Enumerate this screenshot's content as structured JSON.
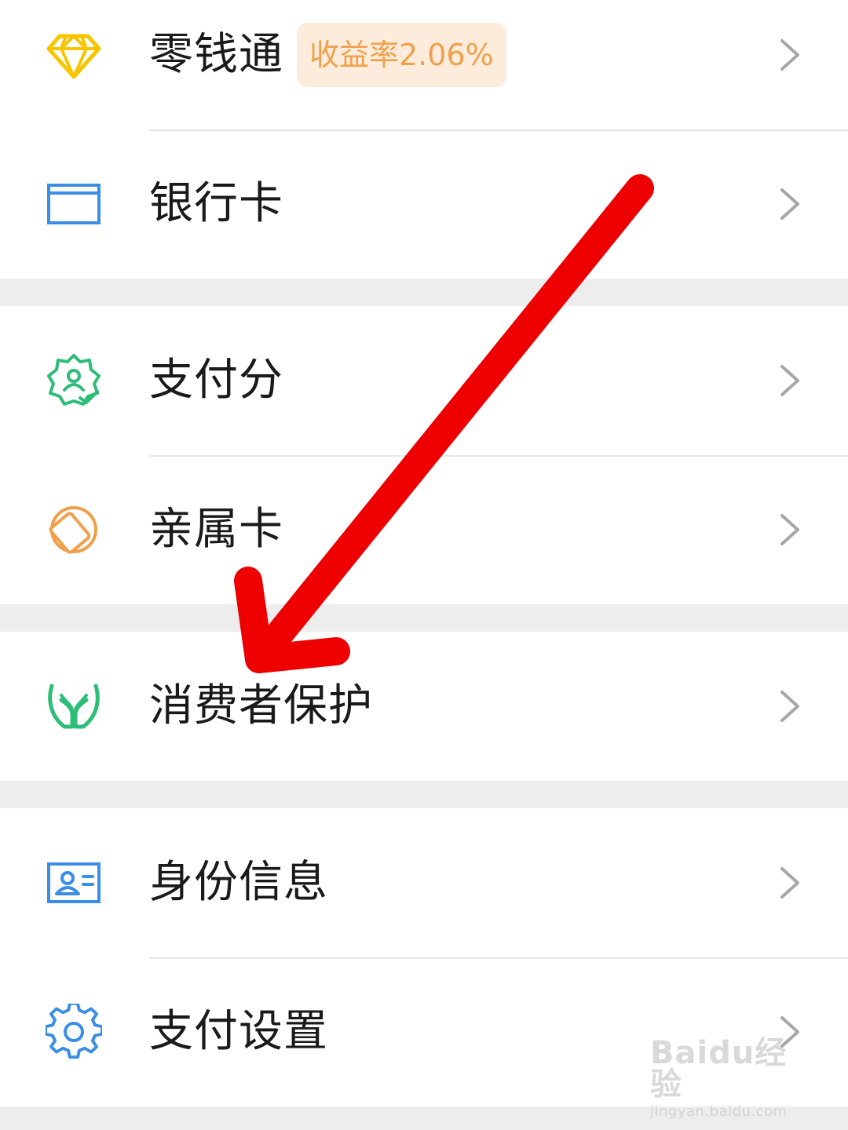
{
  "groups": [
    {
      "items": [
        {
          "label": "零钱通",
          "badge": "收益率2.06%",
          "icon": "diamond-icon"
        },
        {
          "label": "银行卡",
          "icon": "bank-card-icon"
        }
      ]
    },
    {
      "items": [
        {
          "label": "支付分",
          "icon": "credit-score-badge-icon"
        },
        {
          "label": "亲属卡",
          "icon": "family-card-icon"
        }
      ]
    },
    {
      "items": [
        {
          "label": "消费者保护",
          "icon": "protection-hands-icon"
        }
      ]
    },
    {
      "items": [
        {
          "label": "身份信息",
          "icon": "id-card-icon"
        },
        {
          "label": "支付设置",
          "icon": "gear-icon"
        }
      ]
    }
  ],
  "colors": {
    "diamond": "#f7c500",
    "bank_card": "#3a8ee6",
    "credit_score": "#2ebd77",
    "family_card": "#f0a04b",
    "protection": "#2ebd77",
    "id_card": "#3a8ee6",
    "gear": "#3a8ee6",
    "badge_bg": "#fdecdc",
    "badge_text": "#f0a04b",
    "annotation_arrow": "#ee0000"
  },
  "watermark": {
    "main": "Baidu经验",
    "sub": "jingyan.baidu.com"
  }
}
